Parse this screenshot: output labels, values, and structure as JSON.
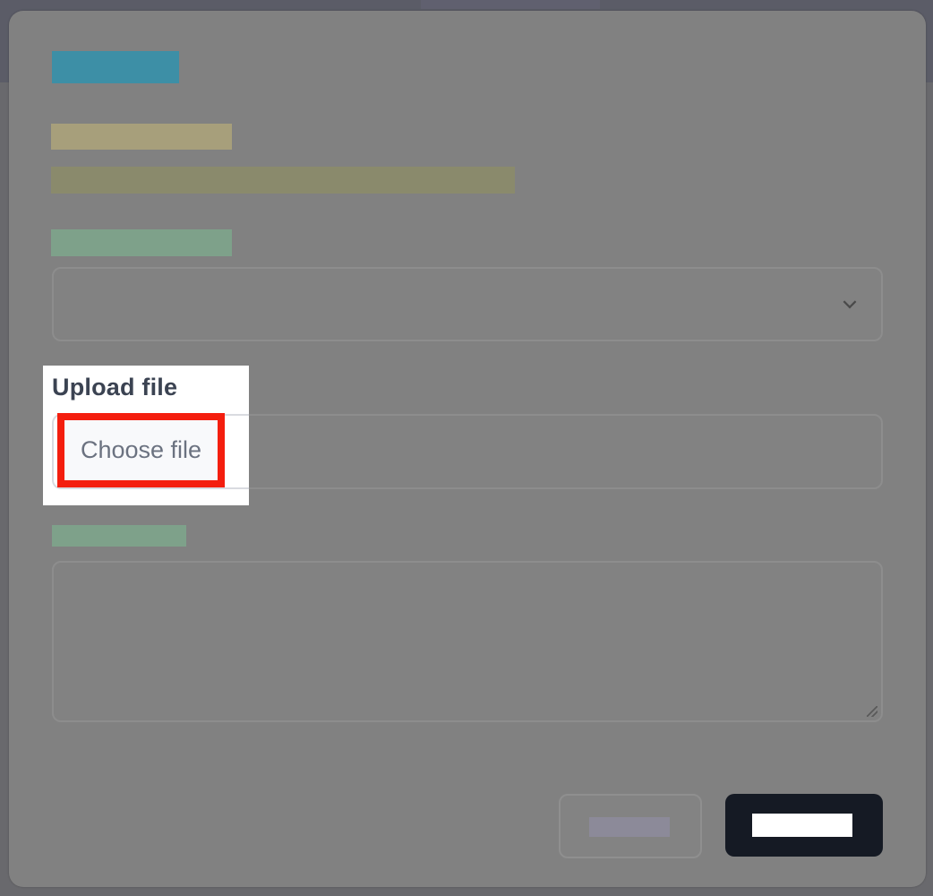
{
  "upload": {
    "label": "Upload file",
    "button_label": "Choose file"
  },
  "colors": {
    "highlight_border": "#f41e0e",
    "submit_button": "#151a24",
    "title_placeholder": "#3d8fa6"
  },
  "icons": {
    "select_chevron": "chevron-down-icon",
    "textarea_grip": "resize-grip-icon"
  }
}
